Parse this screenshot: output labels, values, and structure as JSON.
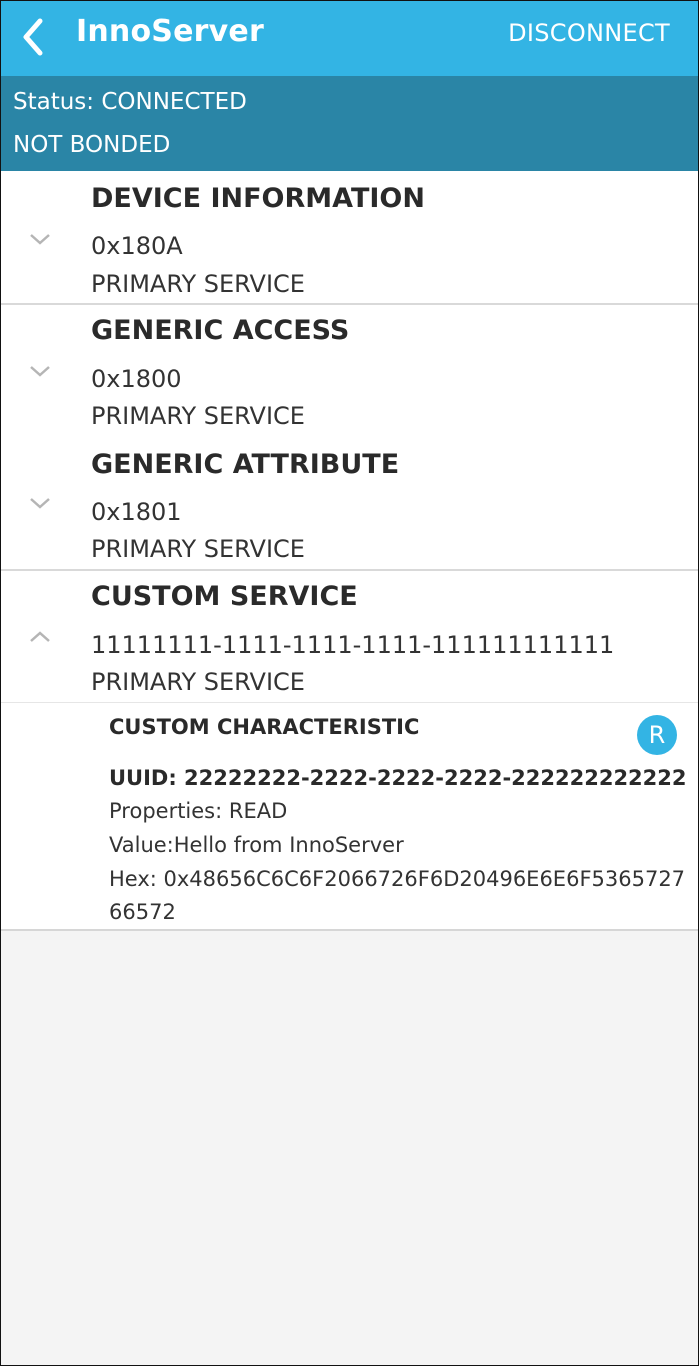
{
  "appbar": {
    "title": "InnoServer",
    "back_icon": "chevron-left-icon",
    "disconnect_label": "DISCONNECT",
    "color": "#33b4e4"
  },
  "status": {
    "connection": "Status: CONNECTED",
    "bond": "NOT BONDED",
    "color": "#2a85a6"
  },
  "services": [
    {
      "name": "DEVICE INFORMATION",
      "uuid": "0x180A",
      "type": "PRIMARY SERVICE",
      "expanded": false
    },
    {
      "name": "GENERIC ACCESS",
      "uuid": "0x1800",
      "type": "PRIMARY SERVICE",
      "expanded": false
    },
    {
      "name": "GENERIC ATTRIBUTE",
      "uuid": "0x1801",
      "type": "PRIMARY SERVICE",
      "expanded": false
    },
    {
      "name": "CUSTOM SERVICE",
      "uuid": "11111111-1111-1111-1111-111111111111",
      "type": "PRIMARY SERVICE",
      "expanded": true
    }
  ],
  "characteristic": {
    "name": "CUSTOM CHARACTERISTIC",
    "badge": "R",
    "uuid": "UUID: 22222222-2222-2222-2222-222222222222",
    "properties": "Properties: READ",
    "value": "Value:Hello from InnoServer",
    "hex_line1": "Hex: 0x48656C6C6F2066726F6D20496E6E6F5365727",
    "hex_line2": "66572"
  }
}
